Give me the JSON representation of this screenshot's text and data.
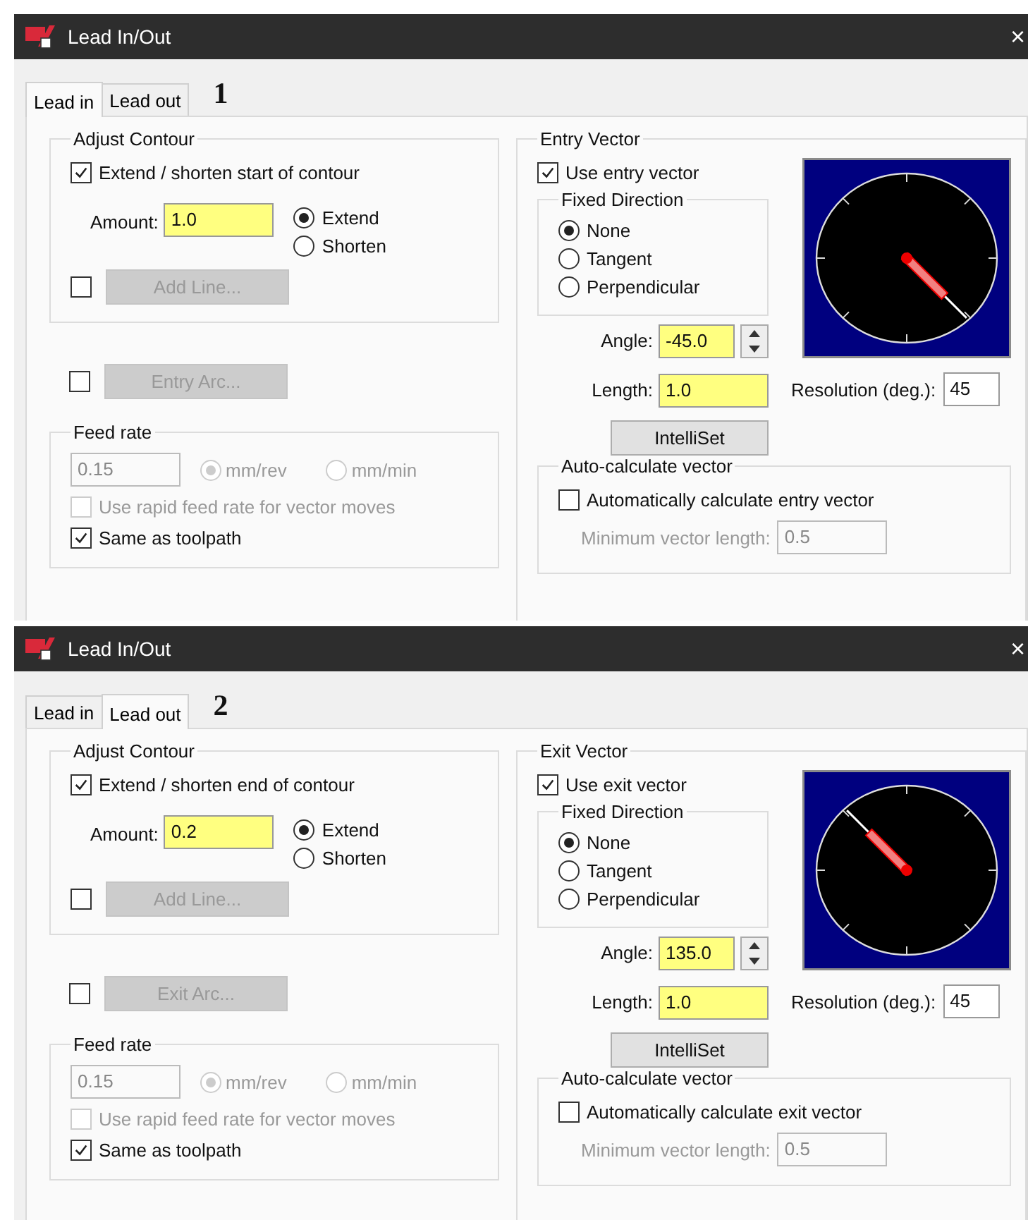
{
  "panels": [
    {
      "number": "1",
      "title": "Lead In/Out",
      "close": "×",
      "tabs": [
        {
          "label": "Lead in",
          "selected": true
        },
        {
          "label": "Lead out",
          "selected": false
        }
      ],
      "adjust_contour": {
        "legend": "Adjust Contour",
        "extend": {
          "label": "Extend / shorten start of contour",
          "checked": true
        },
        "amount_label": "Amount:",
        "amount_value": "1.0",
        "modes": [
          {
            "label": "Extend",
            "selected": true
          },
          {
            "label": "Shorten",
            "selected": false
          }
        ],
        "line": {
          "checked": false,
          "button": "Add Line...",
          "disabled": true
        }
      },
      "arc": {
        "checked": false,
        "button": "Entry Arc...",
        "disabled": true
      },
      "feed_rate": {
        "legend": "Feed rate",
        "value": "0.15",
        "disabled": true,
        "units": [
          {
            "label": "mm/rev",
            "selected": true
          },
          {
            "label": "mm/min",
            "selected": false
          }
        ],
        "rapid": {
          "label": "Use rapid feed rate for vector moves",
          "checked": false
        },
        "same": {
          "label": "Same as toolpath",
          "checked": true
        }
      },
      "vector": {
        "legend": "Entry Vector",
        "use": {
          "label": "Use entry vector",
          "checked": true
        },
        "fixed_direction": {
          "legend": "Fixed Direction",
          "options": [
            {
              "label": "None",
              "selected": true
            },
            {
              "label": "Tangent",
              "selected": false
            },
            {
              "label": "Perpendicular",
              "selected": false
            }
          ]
        },
        "angle_label": "Angle:",
        "angle_value": "-45.0",
        "length_label": "Length:",
        "length_value": "1.0",
        "intelliset": "IntelliSet",
        "resolution_label": "Resolution (deg.):",
        "resolution_value": "45"
      },
      "auto": {
        "legend": "Auto-calculate vector",
        "check": {
          "label": "Automatically calculate entry vector",
          "checked": false
        },
        "min_label": "Minimum vector length:",
        "min_value": "0.5",
        "disabled": true
      }
    },
    {
      "number": "2",
      "title": "Lead In/Out",
      "close": "×",
      "tabs": [
        {
          "label": "Lead in",
          "selected": false
        },
        {
          "label": "Lead out",
          "selected": true
        }
      ],
      "adjust_contour": {
        "legend": "Adjust Contour",
        "extend": {
          "label": "Extend / shorten end of contour",
          "checked": true
        },
        "amount_label": "Amount:",
        "amount_value": "0.2",
        "modes": [
          {
            "label": "Extend",
            "selected": true
          },
          {
            "label": "Shorten",
            "selected": false
          }
        ],
        "line": {
          "checked": false,
          "button": "Add Line...",
          "disabled": true
        }
      },
      "arc": {
        "checked": false,
        "button": "Exit Arc...",
        "disabled": true
      },
      "feed_rate": {
        "legend": "Feed rate",
        "value": "0.15",
        "disabled": true,
        "units": [
          {
            "label": "mm/rev",
            "selected": true
          },
          {
            "label": "mm/min",
            "selected": false
          }
        ],
        "rapid": {
          "label": "Use rapid feed rate for vector moves",
          "checked": false
        },
        "same": {
          "label": "Same as toolpath",
          "checked": true
        }
      },
      "vector": {
        "legend": "Exit Vector",
        "use": {
          "label": "Use exit vector",
          "checked": true
        },
        "fixed_direction": {
          "legend": "Fixed Direction",
          "options": [
            {
              "label": "None",
              "selected": true
            },
            {
              "label": "Tangent",
              "selected": false
            },
            {
              "label": "Perpendicular",
              "selected": false
            }
          ]
        },
        "angle_label": "Angle:",
        "angle_value": "135.0",
        "length_label": "Length:",
        "length_value": "1.0",
        "intelliset": "IntelliSet",
        "resolution_label": "Resolution (deg.):",
        "resolution_value": "45"
      },
      "auto": {
        "legend": "Auto-calculate vector",
        "check": {
          "label": "Automatically calculate exit vector",
          "checked": false
        },
        "min_label": "Minimum vector length:",
        "min_value": "0.5",
        "disabled": true
      }
    }
  ]
}
